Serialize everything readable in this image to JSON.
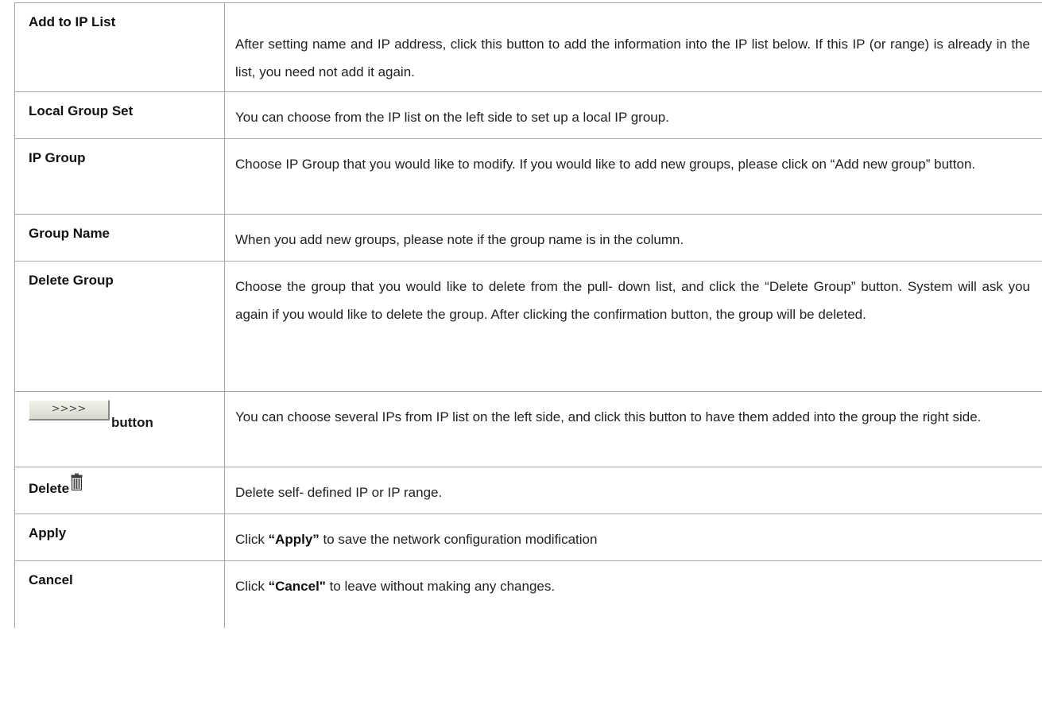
{
  "rows": [
    {
      "term": "Add to IP List",
      "desc": "After setting name and IP address, click this button to add the information into the IP list below. If this IP (or range) is already in the list, you need not add it again."
    },
    {
      "term": "Local Group Set",
      "desc": "You can choose from the IP list on the left side to set up a local IP group."
    },
    {
      "term": "IP Group",
      "desc": "Choose IP Group that you would like to modify. If you would like to add new groups, please click on “Add new group” button."
    },
    {
      "term": "Group Name",
      "desc": "When you add new groups, please note if the group name is in the column."
    },
    {
      "term": "Delete Group",
      "desc": "Choose the group that you would like to delete from the pull- down list, and click the “Delete Group” button. System will ask you again if you would like to delete the group. After clicking the confirmation button, the group will be deleted."
    },
    {
      "button_glyph": ">>>>",
      "term": "button",
      "desc": "You can choose several IPs from IP list on the left side, and click this button to have them added into the group the right side."
    },
    {
      "term": "Delete",
      "icon": "trash-icon",
      "desc": "Delete self- defined IP or IP range."
    },
    {
      "term": "Apply",
      "desc_prefix": "Click ",
      "desc_bold": "“Apply”",
      "desc_suffix": " to save the network configuration modification"
    },
    {
      "term": "Cancel",
      "desc_prefix": "Click ",
      "desc_bold": "“Cancel\"",
      "desc_suffix": " to leave without making any changes."
    }
  ],
  "colors": {
    "border": "#a6a6a6",
    "text": "#222222"
  }
}
